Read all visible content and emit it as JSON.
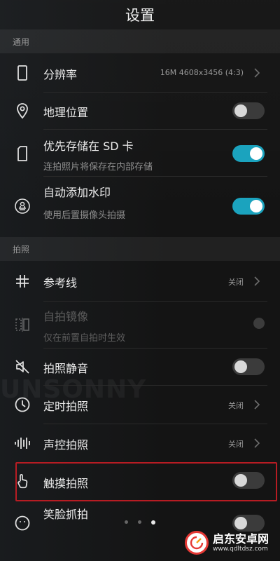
{
  "header": {
    "title": "设置"
  },
  "sections": {
    "general": "通用",
    "photo": "拍照"
  },
  "general_items": [
    {
      "label": "分辨率",
      "value": "16M 4608x3456 (4:3)"
    },
    {
      "label": "地理位置",
      "toggle": "off"
    },
    {
      "label": "优先存储在 SD 卡",
      "sub": "连拍照片将保存在内部存储",
      "toggle": "on"
    },
    {
      "label": "自动添加水印",
      "sub": "使用后置摄像头拍摄",
      "toggle": "on"
    }
  ],
  "photo_items": [
    {
      "label": "参考线",
      "value": "关闭"
    },
    {
      "label": "自拍镜像",
      "sub": "仅在前置自拍时生效",
      "state": "disabled"
    },
    {
      "label": "拍照静音",
      "toggle": "off"
    },
    {
      "label": "定时拍照",
      "value": "关闭"
    },
    {
      "label": "声控拍照",
      "value": "关闭"
    },
    {
      "label": "触摸拍照",
      "toggle": "off"
    },
    {
      "label": "笑脸抓拍",
      "toggle": "off"
    }
  ],
  "pager": {
    "pages": 3,
    "active": 3
  },
  "background_watermark": "UNSONNY",
  "logo": {
    "name": "启东安卓网",
    "url": "www.qdltdsz.com"
  },
  "colors": {
    "accent": "#1ba3be",
    "highlight": "#b71c23"
  }
}
